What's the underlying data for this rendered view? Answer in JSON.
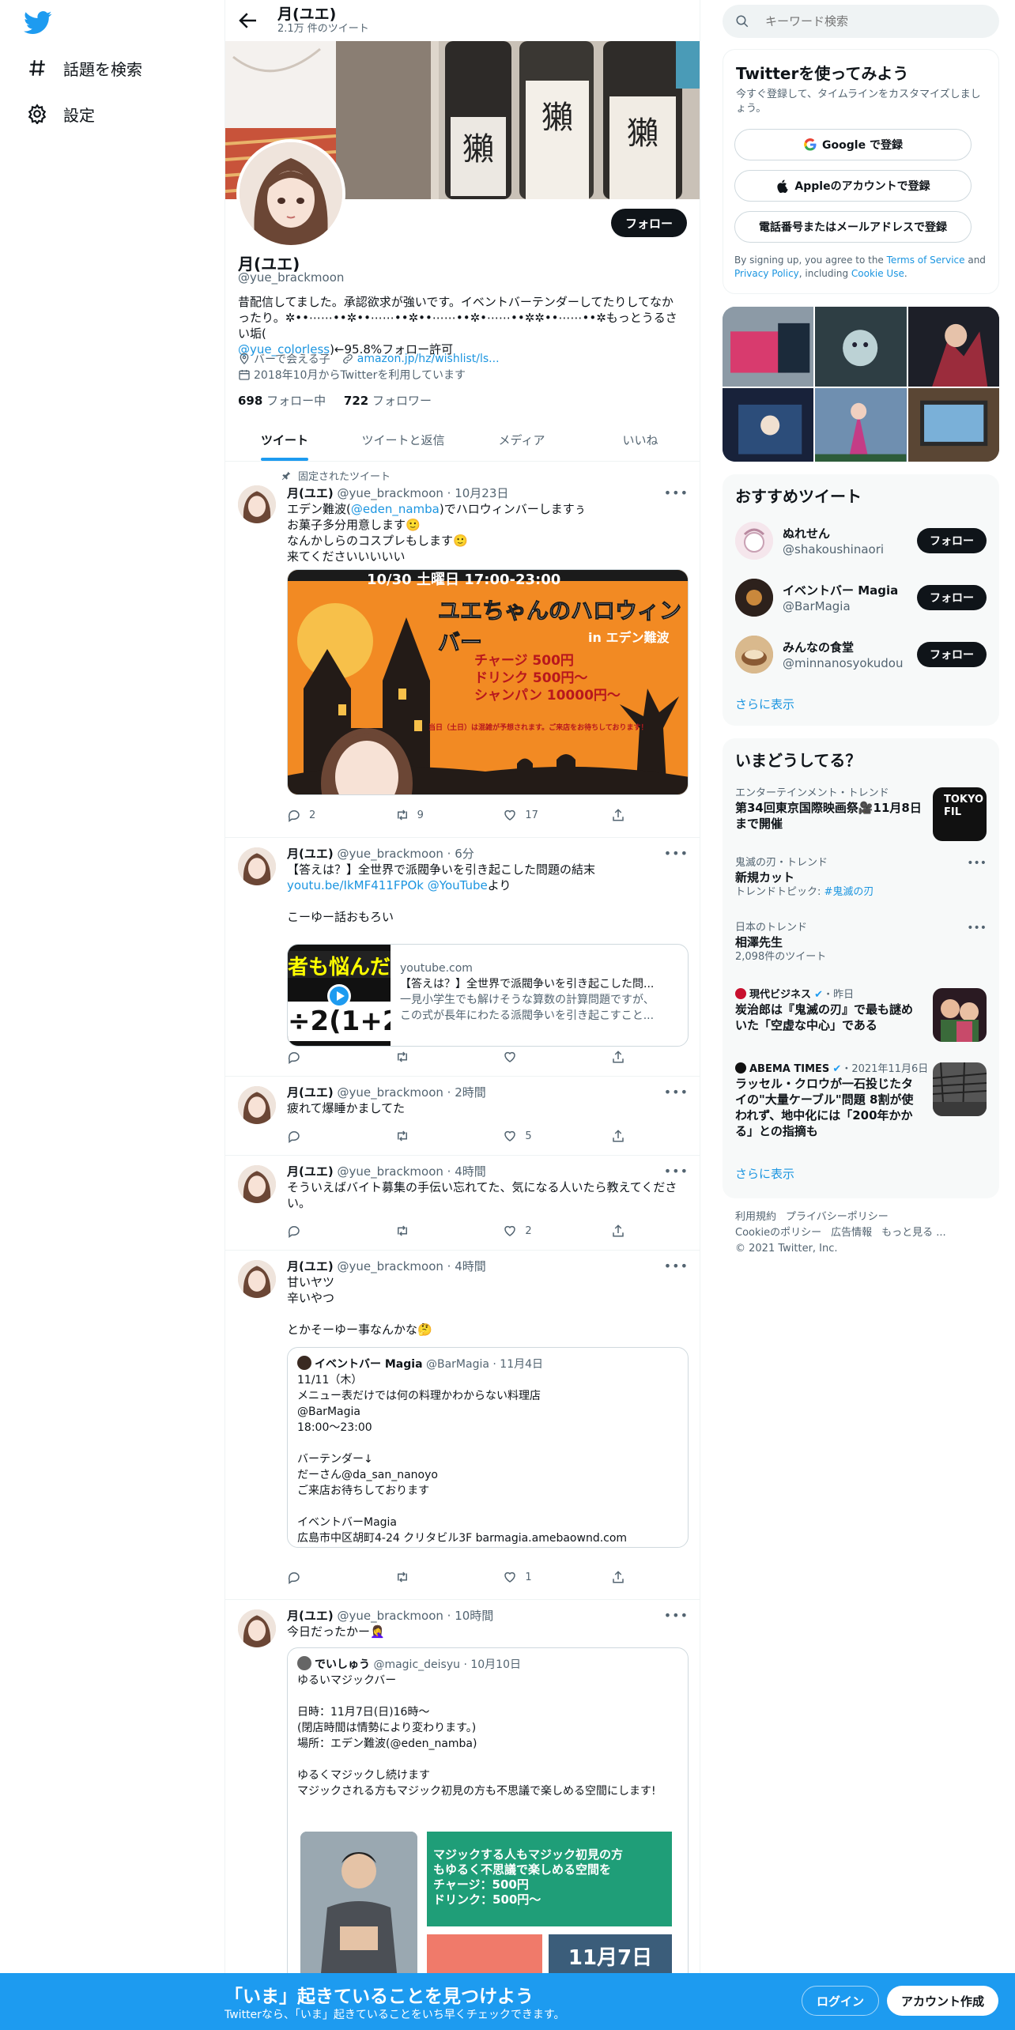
{
  "nav": {
    "explore_label": "話題を検索",
    "settings_label": "設定"
  },
  "profile": {
    "name": "月(ユエ)",
    "tweet_count": "2.1万 件のツイート",
    "handle": "@yue_brackmoon",
    "follow_label": "フォロー",
    "bio_line1": "昔配信してました。承認欲求が強いです。イベントバーテンダーしてたりしてなか",
    "bio_line2": "ったり。✲••⋯⋯••✲••⋯⋯••✲••⋯⋯••✲•⋯⋯••✲✲••⋯⋯••✲もっとうるさい垢(",
    "bio_link": "@yue_colorless",
    "bio_tail": ")←95.8%フォロー許可",
    "location": "バーで会える子",
    "website": "amazon.jp/hz/wishlist/ls...",
    "joined": "2018年10月からTwitterを利用しています",
    "following_count": "698",
    "following_label": "フォロー中",
    "followers_count": "722",
    "followers_label": "フォロワー"
  },
  "tabs": [
    "ツイート",
    "ツイートと返信",
    "メディア",
    "いいね"
  ],
  "pinned_label": "固定されたツイート",
  "tweets": [
    {
      "name": "月(ユエ)",
      "handle": "@yue_brackmoon",
      "time": "10月23日",
      "text_a": "エデン難波(",
      "mention": "@eden_namba",
      "text_b": ")でハロウィンバーしますぅ",
      "text_c": "お菓子多分用意します🙂\nなんかしらのコスプレもします🙂\n来てくださいいいいい",
      "img_title": "ユエちゃんのハロウィンバー",
      "img_sub": "in エデン難波",
      "img_top": "10/30 土曜日 17:00-23:00",
      "img_prices": [
        "チャージ 500円",
        "ドリンク 500円〜",
        "シャンパン 10000円〜"
      ],
      "img_note": "当日（土日）は混雑が予想されます。ご来店をお待ちしております！",
      "replies": "2",
      "retweets": "9",
      "likes": "17"
    },
    {
      "name": "月(ユエ)",
      "handle": "@yue_brackmoon",
      "time": "6分",
      "text_a": "【答えは？】全世界で派閥争いを引き起こした問題の結末",
      "link": "youtu.be/IkMF411FPOk",
      "mention": "@YouTube",
      "text_b": "より",
      "text_c": "こーゆー話おもろい",
      "card_domain": "youtube.com",
      "card_title": "【答えは？】全世界で派閥争いを引き起こした問...",
      "card_desc1": "一見小学生でも解けそうな算数の計算問題ですが、",
      "card_desc2": "この式が長年にわたる派閥争いを引き起こすこと...",
      "card_img_top": "者も悩んだ難",
      "card_img_bottom": "÷2(1+2"
    },
    {
      "name": "月(ユエ)",
      "handle": "@yue_brackmoon",
      "time": "2時間",
      "text": "疲れて爆睡かましてた",
      "likes": "5"
    },
    {
      "name": "月(ユエ)",
      "handle": "@yue_brackmoon",
      "time": "4時間",
      "text": "そういえばバイト募集の手伝い忘れてた、気になる人いたら教えてください。",
      "likes": "2"
    },
    {
      "name": "月(ユエ)",
      "handle": "@yue_brackmoon",
      "time": "4時間",
      "text": "甘いヤツ\n辛いやつ\n\nとかそーゆー事なんかな🤔",
      "q_name": "イベントバー Magia",
      "q_handle": "@BarMagia",
      "q_time": "11月4日",
      "q_text": "11/11（木）\nメニュー表だけでは何の料理かわからない料理店\n@BarMagia\n18:00〜23:00\n\nバーテンダー↓\nだーさん@da_san_nanoyo\nご来店お待ちしております\n\nイベントバーMagia\n広島市中区胡町4-24 クリタビル3F barmagia.amebaownd.com",
      "likes": "1"
    },
    {
      "name": "月(ユエ)",
      "handle": "@yue_brackmoon",
      "time": "10時間",
      "text": "今日だったかー🤦‍♀️",
      "q_name": "でいしゅう",
      "q_handle": "@magic_deisyu",
      "q_time": "10月10日",
      "q_text": "ゆるいマジックバー\n\n日時：11月7日(日)16時〜\n(閉店時間は情勢により変わります。)\n場所：エデン難波(@eden_namba)\n\nゆるくマジックし続けます\nマジックされる方もマジック初見の方も不思議で楽しめる空間にします!",
      "q_img_text": "マジックする人もマジック初見の方\nもゆるく不思議で楽しめる空間を\nチャージ：500円\nドリンク：500円〜",
      "q_img_date": "11月7日"
    }
  ],
  "search": {
    "placeholder": "キーワード検索"
  },
  "signup": {
    "title": "Twitterを使ってみよう",
    "desc": "今すぐ登録して、タイムラインをカスタマイズしましょう。",
    "google": "Google で登録",
    "apple": "Appleのアカウントで登録",
    "phone": "電話番号またはメールアドレスで登録",
    "terms_a": "By signing up, you agree to the ",
    "terms_tos": "Terms of Service",
    "terms_b": " and ",
    "terms_pp": "Privacy Policy",
    "terms_c": ", including ",
    "terms_cookie": "Cookie Use",
    "terms_d": "."
  },
  "recommend": {
    "title": "おすすめツイート",
    "users": [
      {
        "name": "ぬれせん",
        "handle": "@shakoushinaori",
        "btn": "フォロー"
      },
      {
        "name": "イベントバー Magia",
        "handle": "@BarMagia",
        "btn": "フォロー"
      },
      {
        "name": "みんなの食堂",
        "handle": "@minnanosyokudou",
        "btn": "フォロー"
      }
    ],
    "more": "さらに表示"
  },
  "trends": {
    "title": "いまどうしてる？",
    "items": [
      {
        "cat": "エンターテインメント・トレンド",
        "title": "第34回東京国際映画祭🎥11月8日まで開催",
        "thumb_text": "TOKYO FIL"
      },
      {
        "cat": "鬼滅の刃・トレンド",
        "title": "新規カット",
        "sub_a": "トレンドトピック: ",
        "sub_tag": "#鬼滅の刃"
      },
      {
        "cat": "日本のトレンド",
        "title": "相澤先生",
        "sub": "2,098件のツイート"
      },
      {
        "source": "現代ビジネス",
        "time": "・昨日",
        "title": "炭治郎は『鬼滅の刃』で最も謎めいた「空虚な中心」である"
      },
      {
        "source": "ABEMA TIMES",
        "time": "・2021年11月6日",
        "title": "ラッセル・クロウが一石投じたタイの\"大量ケーブル\"問題 8割が使われず、地中化には「200年かかる」との指摘も"
      }
    ],
    "more": "さらに表示"
  },
  "footer": {
    "terms": "利用規約",
    "privacy": "プライバシーポリシー",
    "cookie": "Cookieのポリシー",
    "ads": "広告情報",
    "more": "もっと見る ...",
    "copyright": "© 2021 Twitter, Inc."
  },
  "bottombar": {
    "headline": "「いま」起きていることを見つけよう",
    "sub": "Twitterなら、「いま」起きていることをいち早くチェックできます。",
    "login": "ログイン",
    "signup": "アカウント作成"
  },
  "colors": {
    "accent": "#1d9bf0",
    "text": "#0f1419",
    "muted": "#536471"
  }
}
